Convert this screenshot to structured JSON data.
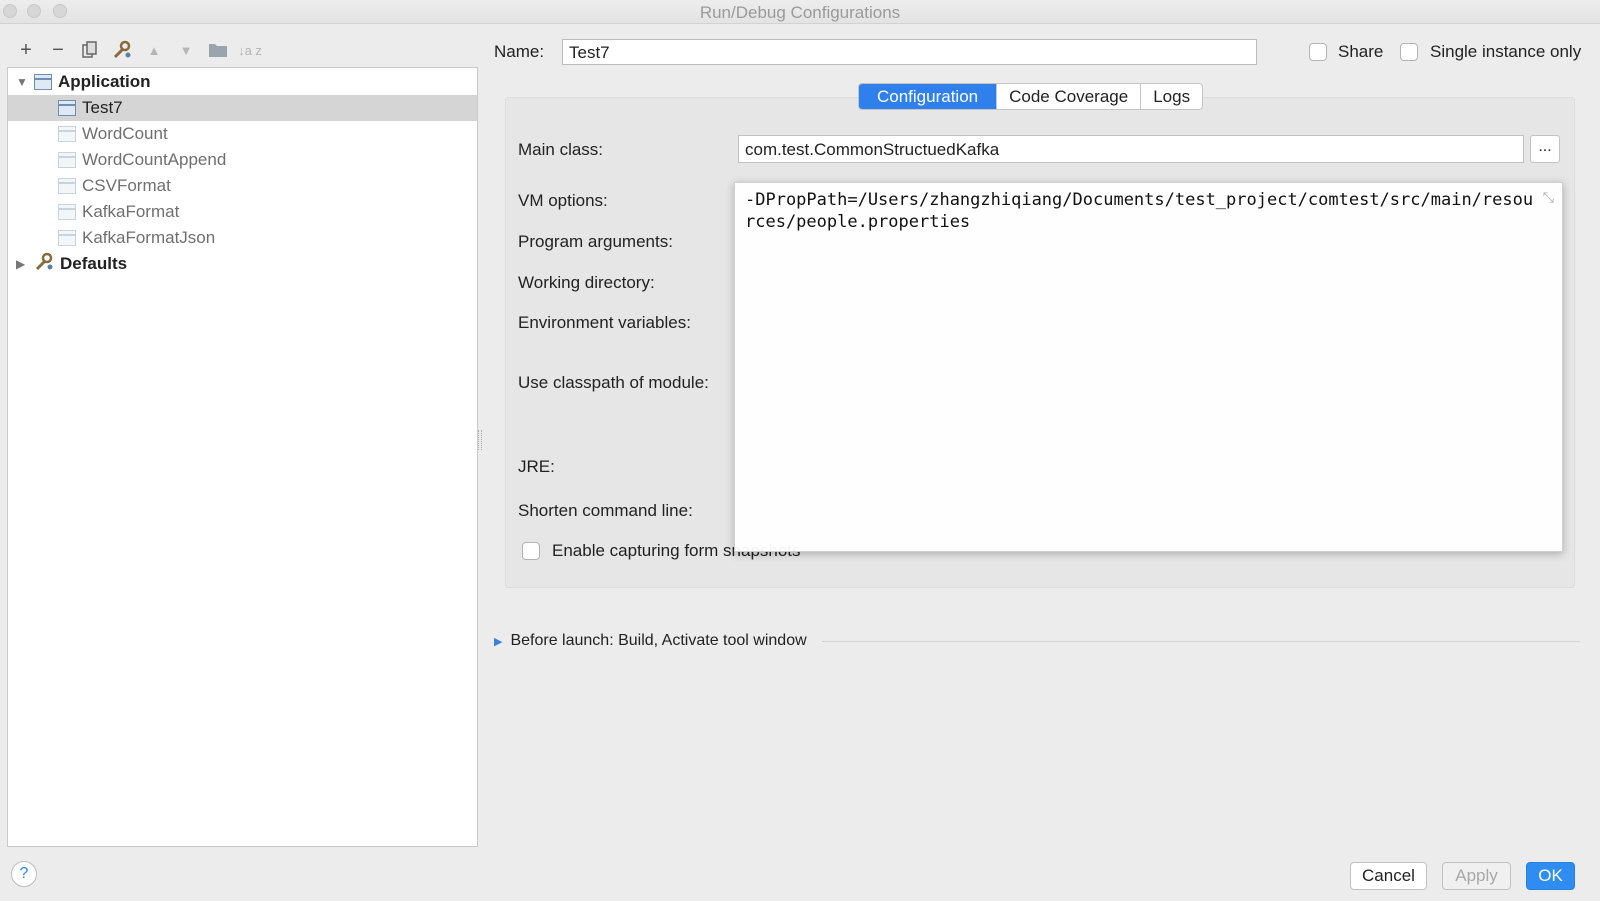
{
  "window": {
    "title": "Run/Debug Configurations"
  },
  "toolbar": {
    "add_icon": "+",
    "remove_icon": "−",
    "copy_icon": "copy-icon",
    "wrench_icon": "wrench-icon",
    "up_icon": "▲",
    "down_icon": "▼",
    "folder_icon": "folder-icon",
    "sort_icon": "↓a z"
  },
  "tree": {
    "application": {
      "label": "Application",
      "arrow": "▼"
    },
    "items": [
      {
        "label": "Test7",
        "selected": true
      },
      {
        "label": "WordCount"
      },
      {
        "label": "WordCountAppend"
      },
      {
        "label": "CSVFormat"
      },
      {
        "label": "KafkaFormat"
      },
      {
        "label": "KafkaFormatJson"
      }
    ],
    "defaults": {
      "label": "Defaults",
      "arrow": "▶"
    }
  },
  "name": {
    "label": "Name:",
    "value": "Test7"
  },
  "options": {
    "share_label": "Share",
    "single_instance_label": "Single instance only"
  },
  "tabs": [
    {
      "label": "Configuration",
      "active": true
    },
    {
      "label": "Code Coverage"
    },
    {
      "label": "Logs"
    }
  ],
  "form": {
    "main_class_label": "Main class:",
    "main_class_value": "com.test.CommonStructuedKafka",
    "browse_label": "...",
    "vm_options_label": "VM options:",
    "program_arguments_label": "Program arguments:",
    "working_directory_label": "Working directory:",
    "environment_variables_label": "Environment variables:",
    "classpath_label": "Use classpath of module:",
    "jre_label": "JRE:",
    "shorten_label": "Shorten command line:",
    "snapshots_label": "Enable capturing form snapshots"
  },
  "vm_popup": {
    "text": "-DPropPath=/Users/zhangzhiqiang/Documents/test_project/comtest/src/main/resources/people.properties",
    "collapse_icon": "⤡"
  },
  "before_launch": {
    "label": "Before launch: Build, Activate tool window"
  },
  "buttons": {
    "help": "?",
    "cancel": "Cancel",
    "apply": "Apply",
    "ok": "OK"
  },
  "colors": {
    "accent": "#2f80ed",
    "selection": "#d5d5d5"
  }
}
